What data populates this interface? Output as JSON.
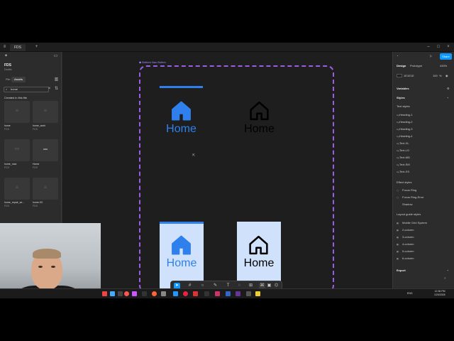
{
  "titlebar": {
    "tab_label": "FDS"
  },
  "left_panel": {
    "file_name": "FDS",
    "file_sub": "Drafts",
    "tabs": [
      "File",
      "Assets"
    ],
    "search_value": "home",
    "section_label": "Created in this file",
    "assets": [
      {
        "name": "home",
        "lib": "FDS"
      },
      {
        "name": "home_work",
        "lib": "FDS"
      },
      {
        "name": "home_max",
        "lib": "FDS"
      },
      {
        "name": "Home",
        "lib": "FDS"
      },
      {
        "name": "home_repair_se...",
        "lib": "FDS"
      },
      {
        "name": "home-03",
        "lib": "FDS"
      }
    ]
  },
  "canvas": {
    "frame_label": "Bottom Nav Button",
    "buttons": [
      {
        "label": "Home",
        "state": "selected-indicator",
        "color": "#2f80ed"
      },
      {
        "label": "Home",
        "state": "default",
        "color": "#000000"
      },
      {
        "label": "Home",
        "state": "selected-pill",
        "color": "#2f80ed"
      },
      {
        "label": "Home",
        "state": "pill",
        "color": "#000000"
      }
    ]
  },
  "right_panel": {
    "tabs": [
      "Design",
      "Prototype"
    ],
    "zoom": "430%",
    "share_label": "Share",
    "fill_hex": "1E1E1E",
    "fill_opacity": "100",
    "fill_pct": "%",
    "variables_label": "Variables",
    "styles_label": "Styles",
    "text_styles_label": "Text styles",
    "text_styles": [
      "Heading-1",
      "Heading-2",
      "Heading-3",
      "Heading-4",
      "Text-XL",
      "Text-LG",
      "Text-MD",
      "Text-SM",
      "Text-XS"
    ],
    "effect_styles_label": "Effect styles",
    "effect_styles": [
      "Focus Ring",
      "Focus Ring-Error",
      "Shadow"
    ],
    "layout_styles_label": "Layout guide styles",
    "layout_styles": [
      "Mobile Grid System",
      "2-column",
      "3-column",
      "4-column",
      "5-column",
      "6-column"
    ],
    "export_label": "Export"
  },
  "taskbar": {
    "lang": "ENG",
    "time": "12:36 PM",
    "date": "1/20/2026"
  },
  "colors": {
    "accent": "#0d99ff",
    "nav_blue": "#2f80ed",
    "frame_purple": "#9b5de5",
    "pill_bg": "#d0e2fb"
  }
}
